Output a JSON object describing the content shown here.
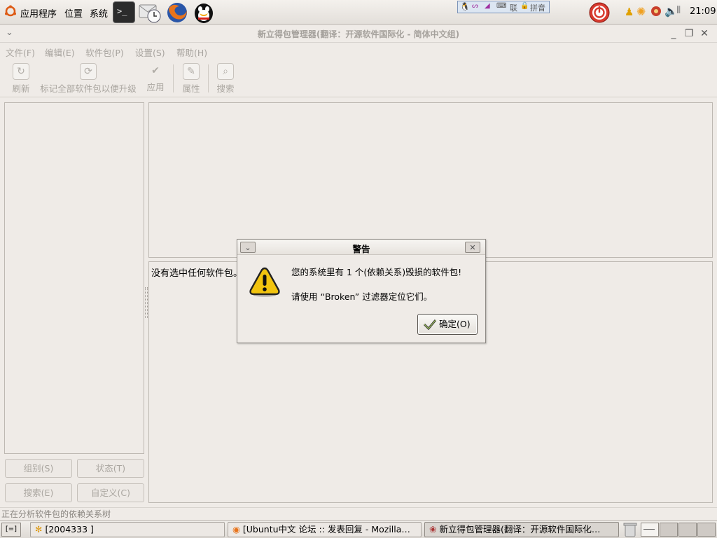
{
  "top_panel": {
    "menus": [
      "应用程序",
      "位置",
      "系统"
    ],
    "ime_items": [
      "联",
      "拼音"
    ],
    "clock": "21:09"
  },
  "window": {
    "title": "新立得包管理器(翻译：开源软件国际化 - 简体中文组)",
    "menu": [
      "文件(F)",
      "编辑(E)",
      "软件包(P)",
      "设置(S)",
      "帮助(H)"
    ],
    "toolbar": {
      "refresh": "刷新",
      "mark_upgrades": "标记全部软件包以便升级",
      "apply": "应用",
      "properties": "属性",
      "search": "搜索"
    },
    "description_text": "没有选中任何软件包。",
    "side_buttons": {
      "sections": "组别(S)",
      "status": "状态(T)",
      "search": "搜索(E)",
      "custom": "自定义(C)"
    },
    "statusbar": "正在分析软件包的依赖关系树"
  },
  "dialog": {
    "title": "警告",
    "message1": "您的系统里有 1 个(依赖关系)毁损的软件包!",
    "message2": "请使用 “Broken” 过滤器定位它们。",
    "ok_label": "确定(O)"
  },
  "taskbar": {
    "items": [
      "[2004333 ]",
      "[Ubuntu中文 论坛 :: 发表回复 - Mozilla…",
      "新立得包管理器(翻译：开源软件国际化…"
    ]
  },
  "colors": {
    "panel": "#efebe7",
    "warning_yellow": "#f2c40f",
    "power_red": "#d83a2e"
  }
}
